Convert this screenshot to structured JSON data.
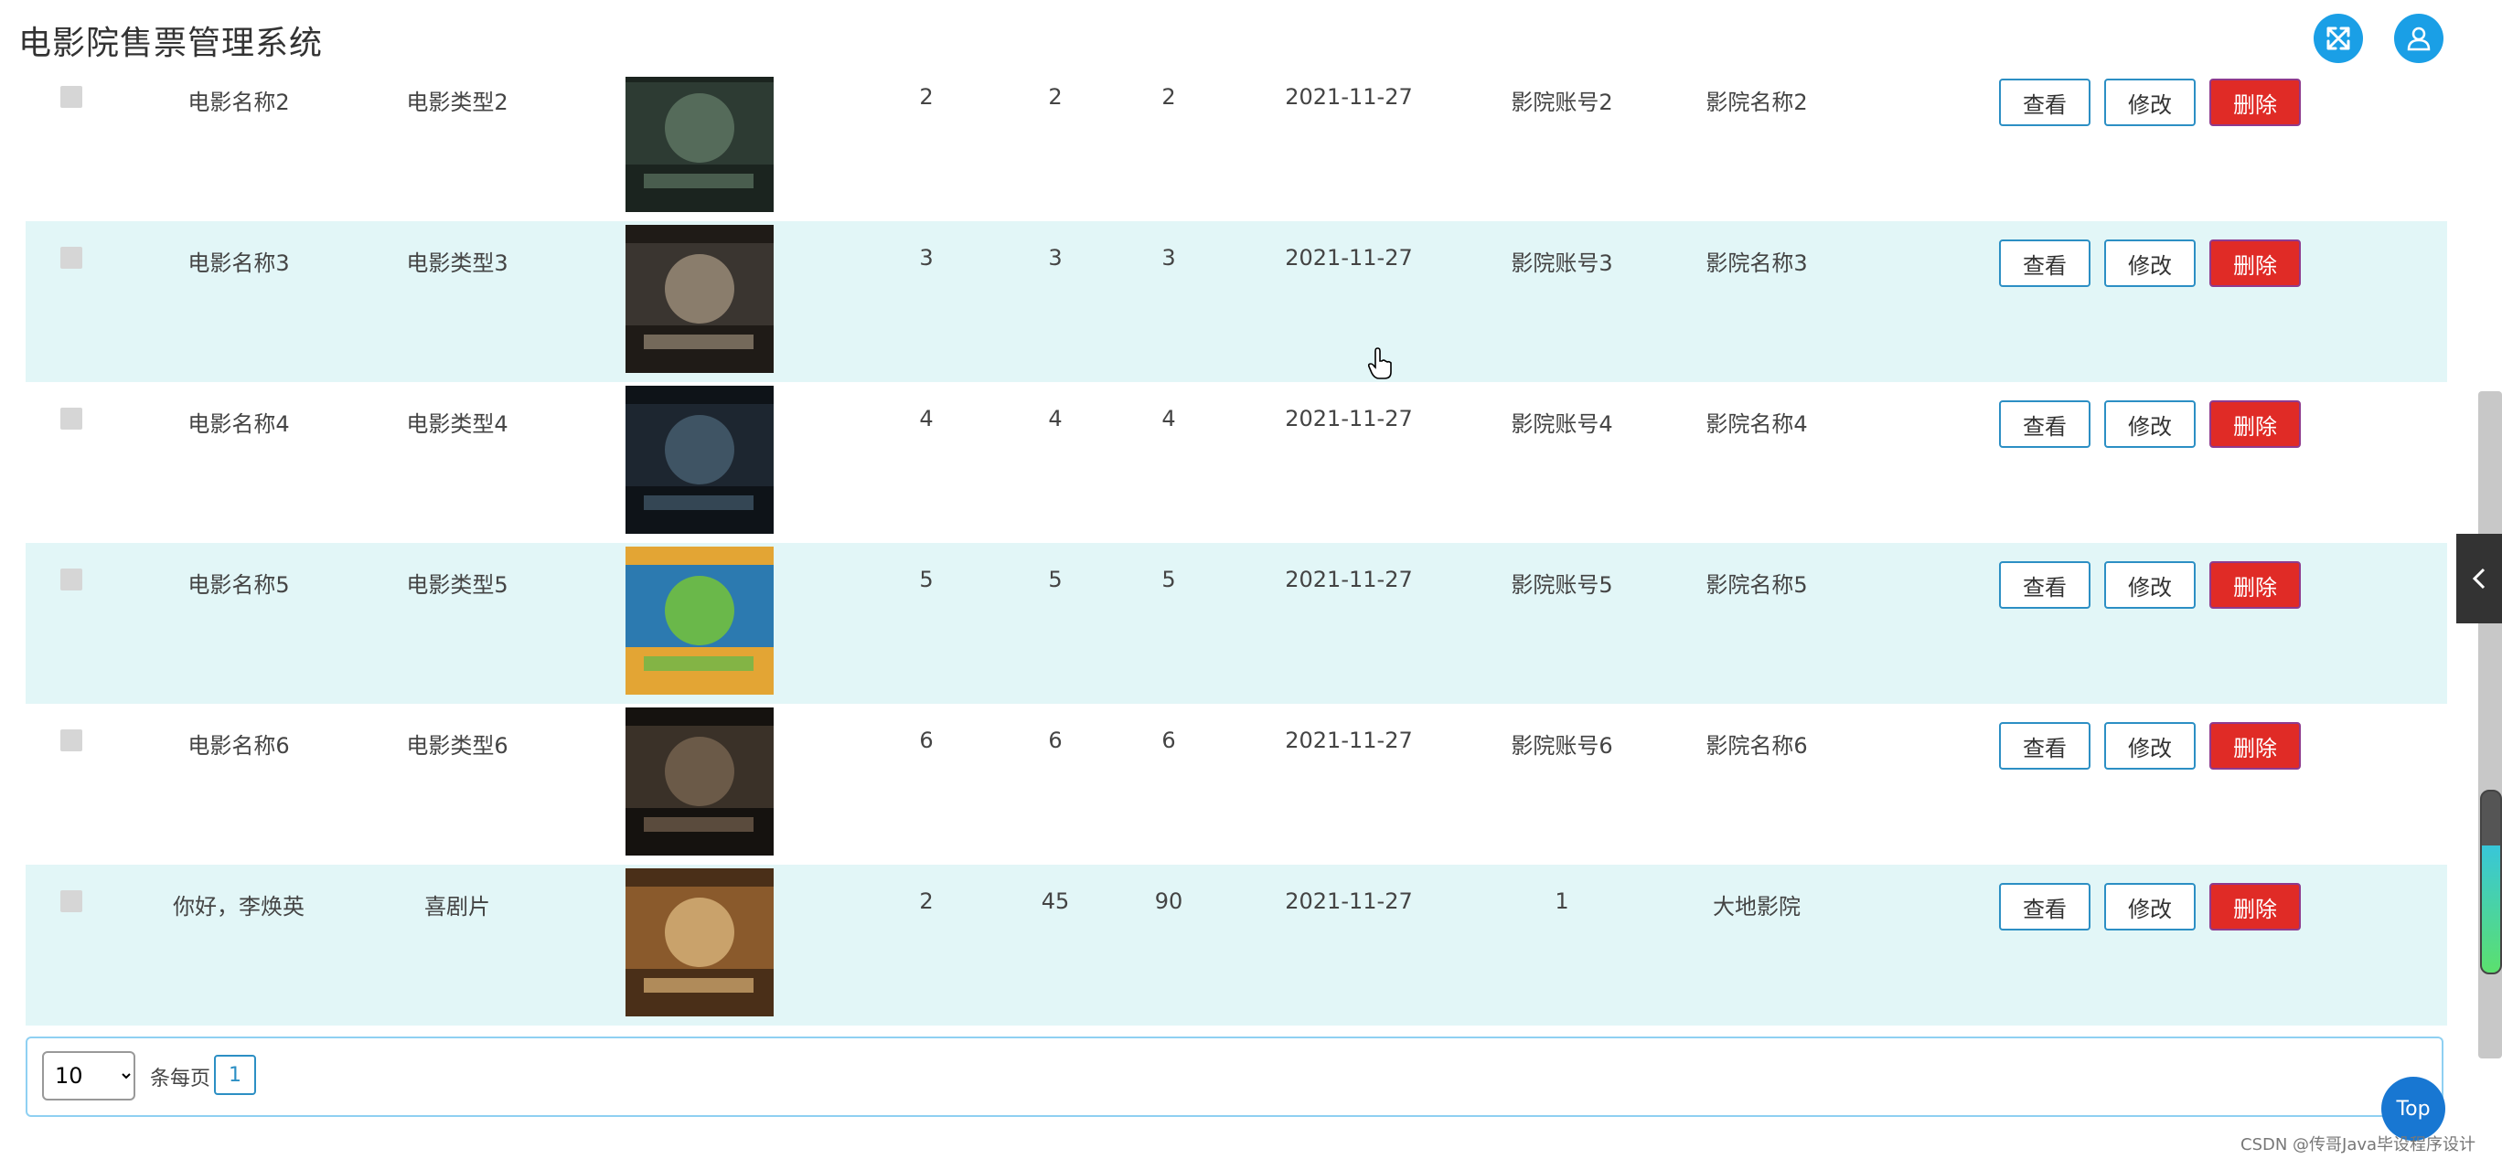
{
  "header": {
    "title": "电影院售票管理系统",
    "icons": [
      "fullscreen-icon",
      "user-icon"
    ],
    "accent": "#1a9fe6"
  },
  "rows": [
    {
      "name": "电影名称2",
      "type": "电影类型2",
      "c1": "2",
      "c2": "2",
      "c3": "2",
      "date": "2021-11-27",
      "account": "影院账号2",
      "cinema": "影院名称2"
    },
    {
      "name": "电影名称3",
      "type": "电影类型3",
      "c1": "3",
      "c2": "3",
      "c3": "3",
      "date": "2021-11-27",
      "account": "影院账号3",
      "cinema": "影院名称3"
    },
    {
      "name": "电影名称4",
      "type": "电影类型4",
      "c1": "4",
      "c2": "4",
      "c3": "4",
      "date": "2021-11-27",
      "account": "影院账号4",
      "cinema": "影院名称4"
    },
    {
      "name": "电影名称5",
      "type": "电影类型5",
      "c1": "5",
      "c2": "5",
      "c3": "5",
      "date": "2021-11-27",
      "account": "影院账号5",
      "cinema": "影院名称5"
    },
    {
      "name": "电影名称6",
      "type": "电影类型6",
      "c1": "6",
      "c2": "6",
      "c3": "6",
      "date": "2021-11-27",
      "account": "影院账号6",
      "cinema": "影院名称6"
    },
    {
      "name": "你好，李焕英",
      "type": "喜剧片",
      "c1": "2",
      "c2": "45",
      "c3": "90",
      "date": "2021-11-27",
      "account": "1",
      "cinema": "大地影院"
    }
  ],
  "actions": {
    "view": "查看",
    "edit": "修改",
    "delete": "删除",
    "delete_color": "#e02b26"
  },
  "pagination": {
    "page_size": "10",
    "page_size_options": [
      "10"
    ],
    "per_page_label": "条每页",
    "current_page": "1"
  },
  "top_button": "Top",
  "watermark": "CSDN @传哥Java毕设程序设计"
}
